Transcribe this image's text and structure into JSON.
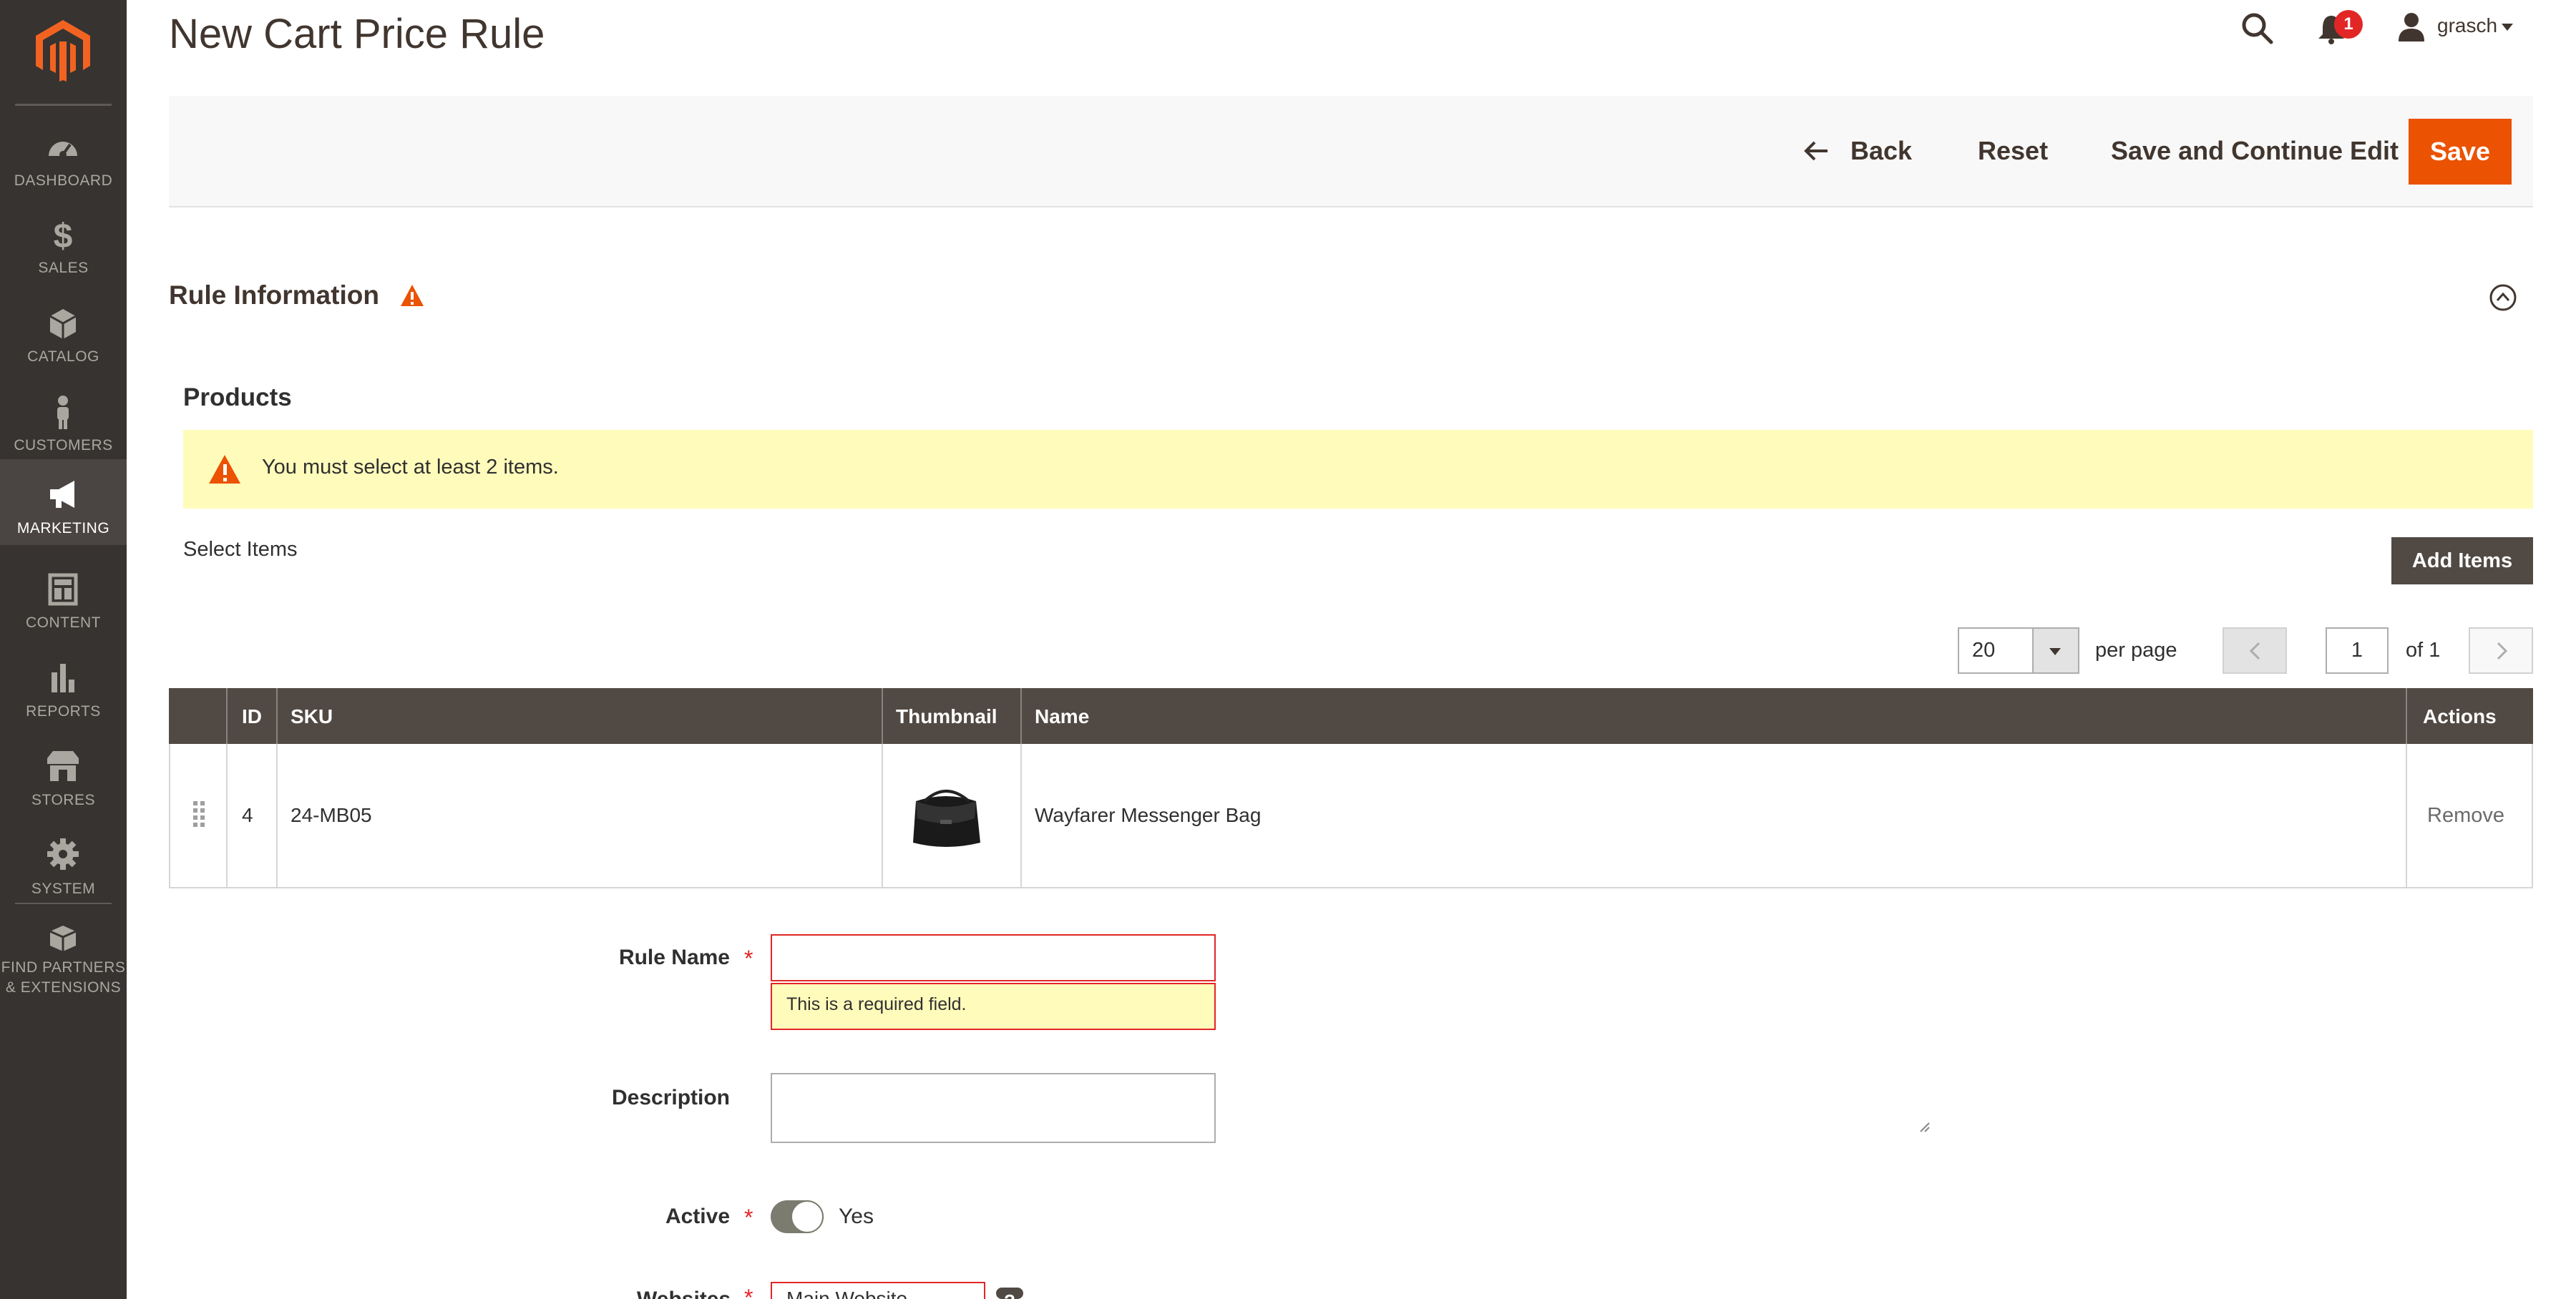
{
  "window": {
    "title": "New Cart Price Rule"
  },
  "header": {
    "notification_count": "1",
    "username": "grasch"
  },
  "sidebar": {
    "items": [
      {
        "label": "DASHBOARD",
        "icon": "dashboard-icon"
      },
      {
        "label": "SALES",
        "icon": "dollar-icon"
      },
      {
        "label": "CATALOG",
        "icon": "box-icon"
      },
      {
        "label": "CUSTOMERS",
        "icon": "person-icon"
      },
      {
        "label": "MARKETING",
        "icon": "megaphone-icon",
        "active": true
      },
      {
        "label": "CONTENT",
        "icon": "layout-icon"
      },
      {
        "label": "REPORTS",
        "icon": "bar-chart-icon"
      },
      {
        "label": "STORES",
        "icon": "storefront-icon"
      },
      {
        "label": "SYSTEM",
        "icon": "gear-icon"
      },
      {
        "label_line1": "FIND PARTNERS",
        "label_line2": "& EXTENSIONS",
        "icon": "extensions-box-icon"
      }
    ]
  },
  "toolbar": {
    "back_label": "Back",
    "reset_label": "Reset",
    "save_continue_label": "Save and Continue Edit",
    "save_label": "Save"
  },
  "section": {
    "title": "Rule Information"
  },
  "products": {
    "title": "Products",
    "error_message": "You must select at least 2 items.",
    "select_label": "Select Items",
    "add_button": "Add Items",
    "pager": {
      "per_page": "20",
      "per_page_label": "per page",
      "current_page": "1",
      "of_label": "of 1"
    },
    "columns": [
      "ID",
      "SKU",
      "Thumbnail",
      "Name",
      "Actions"
    ],
    "rows": [
      {
        "id": "4",
        "sku": "24-MB05",
        "name": "Wayfarer Messenger Bag",
        "action": "Remove"
      }
    ]
  },
  "form": {
    "rule_name_label": "Rule Name",
    "rule_name_value": "",
    "rule_name_error": "This is a required field.",
    "description_label": "Description",
    "description_value": "",
    "active_label": "Active",
    "active_value": "Yes",
    "websites_label": "Websites",
    "websites_value": "Main Website"
  },
  "colors": {
    "sidebar_bg": "#373330",
    "accent": "#eb5202",
    "grid_header": "#514943",
    "message_bg": "#fffbbb",
    "error": "#e22626"
  }
}
